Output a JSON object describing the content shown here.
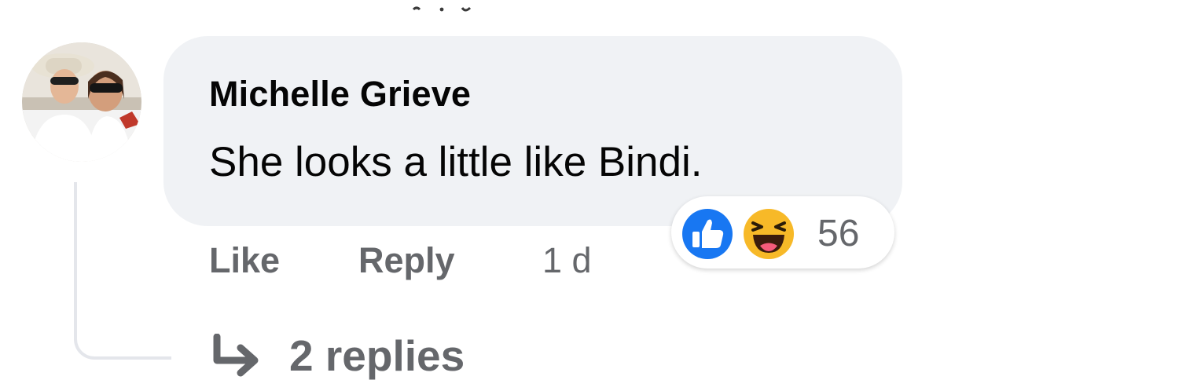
{
  "comment": {
    "author": "Michelle Grieve",
    "text": "She looks a little like Bindi.",
    "reactions": {
      "types": [
        "like-icon",
        "haha-icon"
      ],
      "count": "56"
    },
    "actions": {
      "like_label": "Like",
      "reply_label": "Reply",
      "timestamp": "1 d"
    },
    "replies_label": "2 replies"
  },
  "colors": {
    "bubble_bg": "#f0f2f5",
    "primary_text": "#050505",
    "secondary_text": "#65676b",
    "like_blue": "#1877f2",
    "haha_yellow": "#f7b928",
    "thread_line": "#e4e6eb"
  }
}
